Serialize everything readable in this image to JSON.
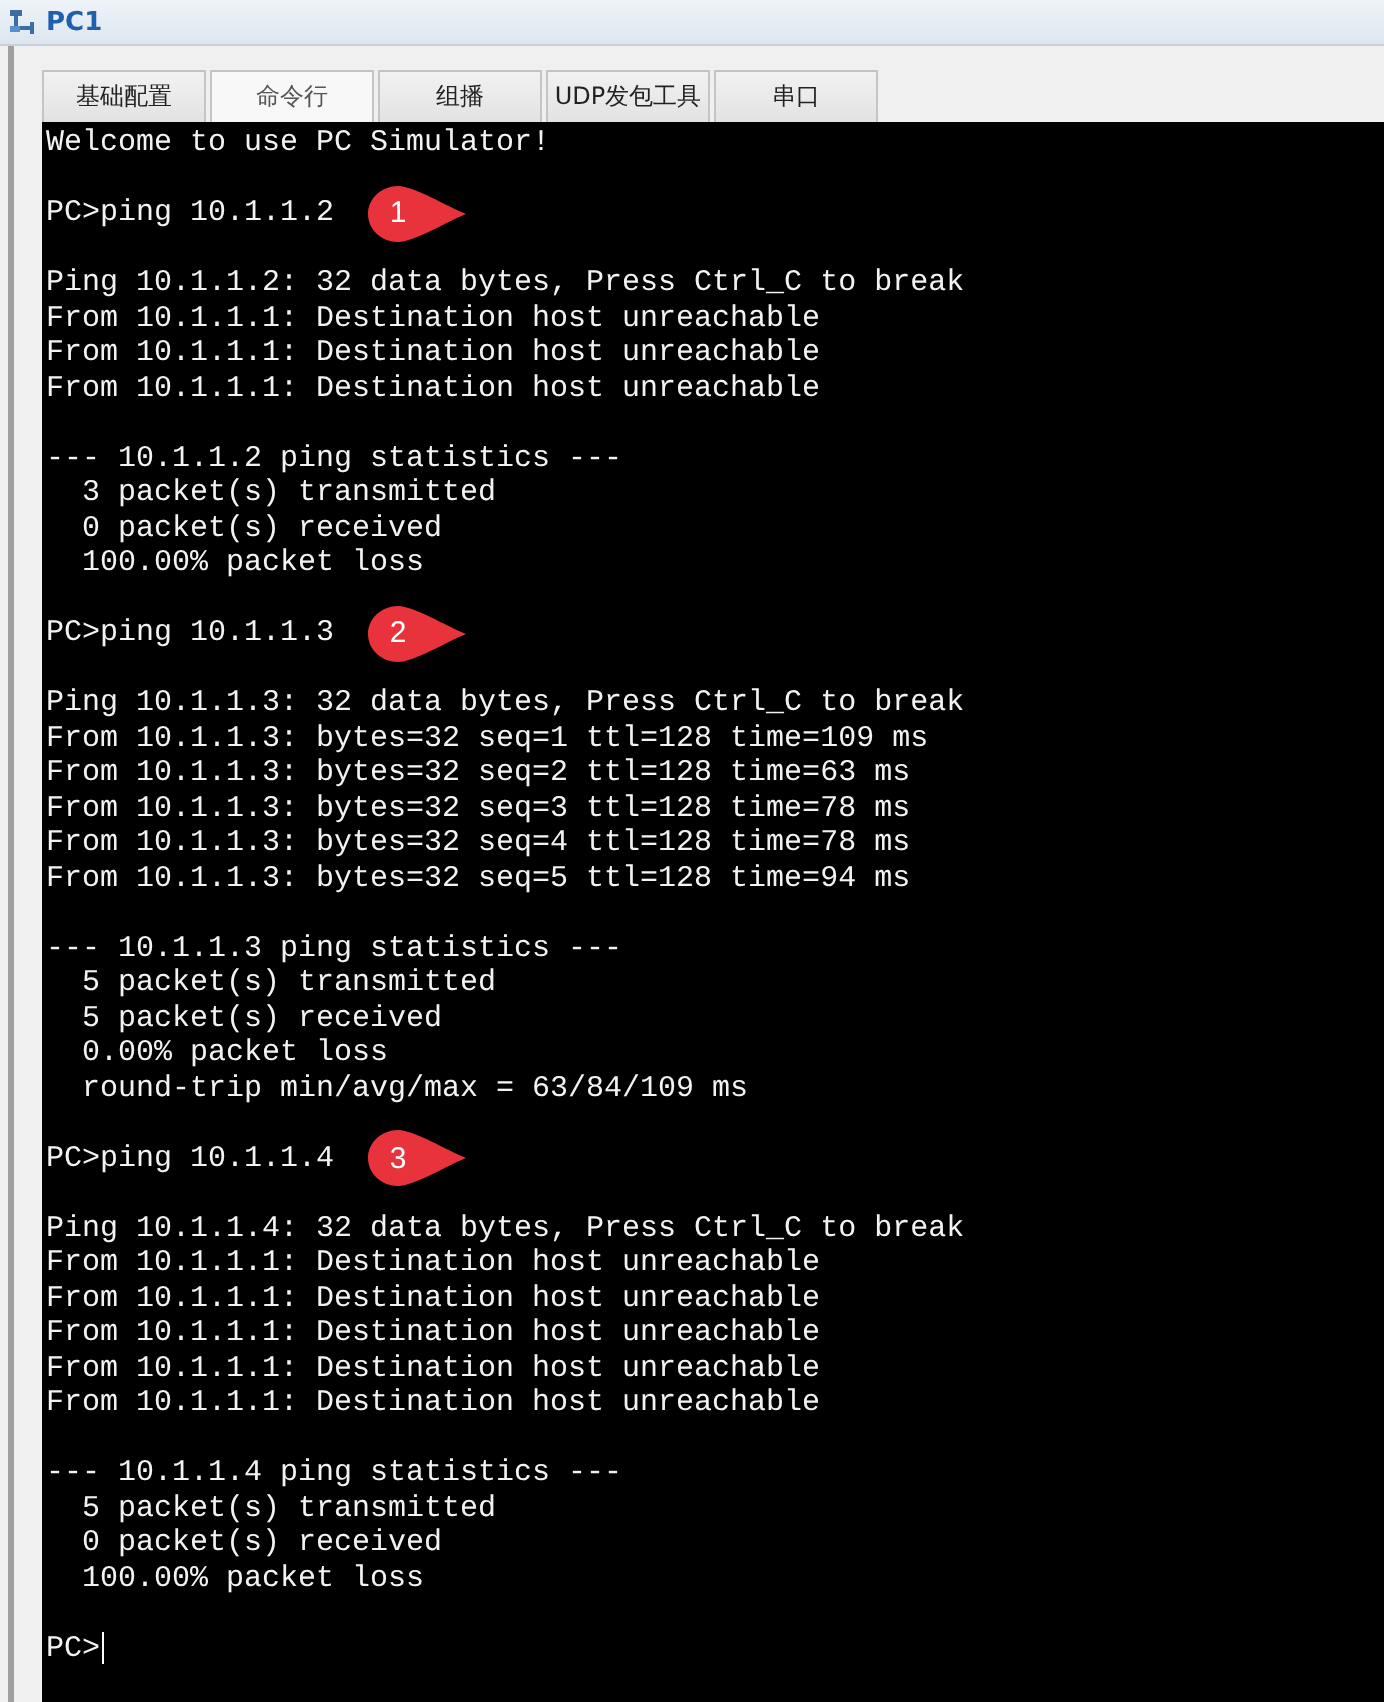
{
  "window": {
    "title": "PC1"
  },
  "tabs": [
    {
      "label": "基础配置",
      "selected": false
    },
    {
      "label": "命令行",
      "selected": true
    },
    {
      "label": "组播",
      "selected": false
    },
    {
      "label": "UDP发包工具",
      "selected": false
    },
    {
      "label": "串口",
      "selected": false
    }
  ],
  "terminal": {
    "lines": [
      {
        "kind": "text",
        "text": "Welcome to use PC Simulator!"
      },
      {
        "kind": "blank"
      },
      {
        "kind": "text",
        "text": "PC>ping 10.1.1.2",
        "marker": "1"
      },
      {
        "kind": "blank"
      },
      {
        "kind": "text",
        "text": "Ping 10.1.1.2: 32 data bytes, Press Ctrl_C to break"
      },
      {
        "kind": "text",
        "text": "From 10.1.1.1: Destination host unreachable"
      },
      {
        "kind": "text",
        "text": "From 10.1.1.1: Destination host unreachable"
      },
      {
        "kind": "text",
        "text": "From 10.1.1.1: Destination host unreachable"
      },
      {
        "kind": "blank"
      },
      {
        "kind": "text",
        "text": "--- 10.1.1.2 ping statistics ---"
      },
      {
        "kind": "text",
        "text": "  3 packet(s) transmitted"
      },
      {
        "kind": "text",
        "text": "  0 packet(s) received"
      },
      {
        "kind": "text",
        "text": "  100.00% packet loss"
      },
      {
        "kind": "blank"
      },
      {
        "kind": "text",
        "text": "PC>ping 10.1.1.3",
        "marker": "2"
      },
      {
        "kind": "blank"
      },
      {
        "kind": "text",
        "text": "Ping 10.1.1.3: 32 data bytes, Press Ctrl_C to break"
      },
      {
        "kind": "text",
        "text": "From 10.1.1.3: bytes=32 seq=1 ttl=128 time=109 ms"
      },
      {
        "kind": "text",
        "text": "From 10.1.1.3: bytes=32 seq=2 ttl=128 time=63 ms"
      },
      {
        "kind": "text",
        "text": "From 10.1.1.3: bytes=32 seq=3 ttl=128 time=78 ms"
      },
      {
        "kind": "text",
        "text": "From 10.1.1.3: bytes=32 seq=4 ttl=128 time=78 ms"
      },
      {
        "kind": "text",
        "text": "From 10.1.1.3: bytes=32 seq=5 ttl=128 time=94 ms"
      },
      {
        "kind": "blank"
      },
      {
        "kind": "text",
        "text": "--- 10.1.1.3 ping statistics ---"
      },
      {
        "kind": "text",
        "text": "  5 packet(s) transmitted"
      },
      {
        "kind": "text",
        "text": "  5 packet(s) received"
      },
      {
        "kind": "text",
        "text": "  0.00% packet loss"
      },
      {
        "kind": "text",
        "text": "  round-trip min/avg/max = 63/84/109 ms"
      },
      {
        "kind": "blank"
      },
      {
        "kind": "text",
        "text": "PC>ping 10.1.1.4",
        "marker": "3"
      },
      {
        "kind": "blank"
      },
      {
        "kind": "text",
        "text": "Ping 10.1.1.4: 32 data bytes, Press Ctrl_C to break"
      },
      {
        "kind": "text",
        "text": "From 10.1.1.1: Destination host unreachable"
      },
      {
        "kind": "text",
        "text": "From 10.1.1.1: Destination host unreachable"
      },
      {
        "kind": "text",
        "text": "From 10.1.1.1: Destination host unreachable"
      },
      {
        "kind": "text",
        "text": "From 10.1.1.1: Destination host unreachable"
      },
      {
        "kind": "text",
        "text": "From 10.1.1.1: Destination host unreachable"
      },
      {
        "kind": "blank"
      },
      {
        "kind": "text",
        "text": "--- 10.1.1.4 ping statistics ---"
      },
      {
        "kind": "text",
        "text": "  5 packet(s) transmitted"
      },
      {
        "kind": "text",
        "text": "  0 packet(s) received"
      },
      {
        "kind": "text",
        "text": "  100.00% packet loss"
      },
      {
        "kind": "blank"
      },
      {
        "kind": "prompt",
        "text": "PC>"
      }
    ]
  }
}
